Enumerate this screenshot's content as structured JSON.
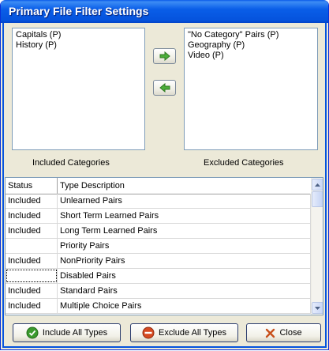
{
  "window": {
    "title": "Primary File Filter Settings"
  },
  "included": {
    "items": [
      "Capitals (P)",
      "History (P)"
    ],
    "label": "Included Categories"
  },
  "excluded": {
    "items": [
      "\"No Category\" Pairs (P)",
      "Geography (P)",
      "Video (P)"
    ],
    "label": "Excluded Categories"
  },
  "grid": {
    "headers": {
      "status": "Status",
      "description": "Type Description"
    },
    "rows": [
      {
        "status": "Included",
        "description": "Unlearned Pairs"
      },
      {
        "status": "Included",
        "description": "Short Term Learned Pairs"
      },
      {
        "status": "Included",
        "description": "Long Term Learned Pairs"
      },
      {
        "status": "",
        "description": "Priority Pairs"
      },
      {
        "status": "Included",
        "description": "NonPriority Pairs"
      },
      {
        "status": "",
        "description": "Disabled Pairs"
      },
      {
        "status": "Included",
        "description": "Standard Pairs"
      },
      {
        "status": "Included",
        "description": "Multiple Choice Pairs"
      }
    ]
  },
  "buttons": {
    "move_right_icon": "arrow-right-icon",
    "move_left_icon": "arrow-left-icon",
    "include_all": "Include All Types",
    "exclude_all": "Exclude All Types",
    "close": "Close"
  },
  "colors": {
    "titlebar": "#0553dd",
    "face": "#ece9d8",
    "arrow_green": "#4cae3a",
    "include_green": "#3b9a2e",
    "exclude_red": "#d64a22",
    "close_x": "#c8501c"
  }
}
